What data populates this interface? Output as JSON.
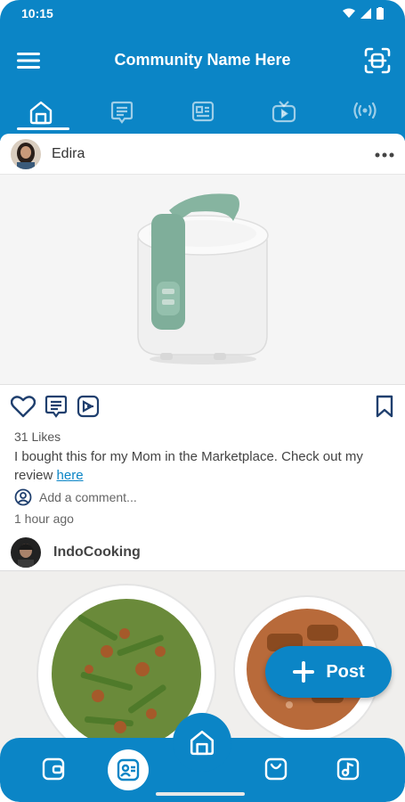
{
  "status_bar": {
    "time": "10:15"
  },
  "app_bar": {
    "title": "Community Name Here"
  },
  "tabs": [
    {
      "id": "home",
      "icon": "home-icon",
      "active": true
    },
    {
      "id": "chat",
      "icon": "chat-icon",
      "active": false
    },
    {
      "id": "news",
      "icon": "news-icon",
      "active": false
    },
    {
      "id": "tv",
      "icon": "tv-icon",
      "active": false
    },
    {
      "id": "live",
      "icon": "broadcast-icon",
      "active": false
    }
  ],
  "posts": [
    {
      "author": "Edira",
      "likes": "31 Likes",
      "caption_text": "I bought this for my Mom in the Marketplace. Check out my review ",
      "caption_link": "here",
      "comment_placeholder": "Add a comment...",
      "time_ago": "1 hour ago"
    },
    {
      "author": "IndoCooking"
    }
  ],
  "fab": {
    "label": "Post"
  },
  "colors": {
    "primary": "#0b85c6",
    "accent": "#ffffff",
    "text": "#222222"
  }
}
